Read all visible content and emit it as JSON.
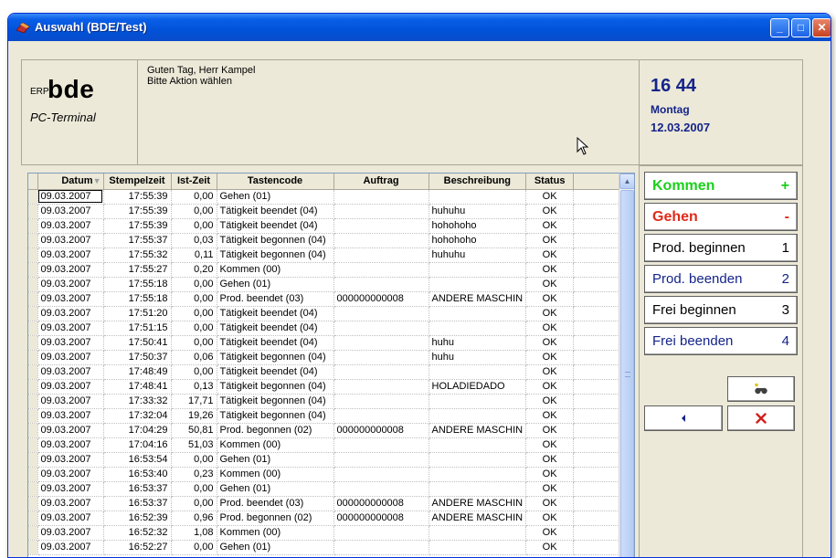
{
  "window": {
    "title": "Auswahl (BDE/Test)",
    "buttons": {
      "minimize": "_",
      "maximize": "□",
      "close": "✕"
    }
  },
  "header": {
    "logo_erp": "ERP",
    "logo_bde": "bde",
    "logo_sub": "PC-Terminal",
    "greeting_line1": "Guten Tag, Herr Kampel",
    "greeting_line2": "Bitte Aktion wählen",
    "time": "16 44",
    "weekday": "Montag",
    "date": "12.03.2007"
  },
  "table": {
    "columns": [
      "Datum",
      "Stempelzeit",
      "Ist-Zeit",
      "Tastencode",
      "Auftrag",
      "Beschreibung",
      "Status"
    ],
    "rows": [
      [
        "09.03.2007",
        "17:55:39",
        "0,00",
        "Gehen (01)",
        "",
        "",
        "OK"
      ],
      [
        "09.03.2007",
        "17:55:39",
        "0,00",
        "Tätigkeit beendet (04)",
        "",
        "huhuhu",
        "OK"
      ],
      [
        "09.03.2007",
        "17:55:39",
        "0,00",
        "Tätigkeit beendet (04)",
        "",
        "hohohoho",
        "OK"
      ],
      [
        "09.03.2007",
        "17:55:37",
        "0,03",
        "Tätigkeit begonnen (04)",
        "",
        "hohohoho",
        "OK"
      ],
      [
        "09.03.2007",
        "17:55:32",
        "0,11",
        "Tätigkeit begonnen (04)",
        "",
        "huhuhu",
        "OK"
      ],
      [
        "09.03.2007",
        "17:55:27",
        "0,20",
        "Kommen (00)",
        "",
        "",
        "OK"
      ],
      [
        "09.03.2007",
        "17:55:18",
        "0,00",
        "Gehen (01)",
        "",
        "",
        "OK"
      ],
      [
        "09.03.2007",
        "17:55:18",
        "0,00",
        "Prod. beendet (03)",
        "000000000008",
        "ANDERE MASCHIN",
        "OK"
      ],
      [
        "09.03.2007",
        "17:51:20",
        "0,00",
        "Tätigkeit beendet (04)",
        "",
        "",
        "OK"
      ],
      [
        "09.03.2007",
        "17:51:15",
        "0,00",
        "Tätigkeit beendet (04)",
        "",
        "",
        "OK"
      ],
      [
        "09.03.2007",
        "17:50:41",
        "0,00",
        "Tätigkeit beendet (04)",
        "",
        "huhu",
        "OK"
      ],
      [
        "09.03.2007",
        "17:50:37",
        "0,06",
        "Tätigkeit begonnen (04)",
        "",
        "huhu",
        "OK"
      ],
      [
        "09.03.2007",
        "17:48:49",
        "0,00",
        "Tätigkeit beendet (04)",
        "",
        "",
        "OK"
      ],
      [
        "09.03.2007",
        "17:48:41",
        "0,13",
        "Tätigkeit begonnen (04)",
        "",
        "HOLADIEDADO",
        "OK"
      ],
      [
        "09.03.2007",
        "17:33:32",
        "17,71",
        "Tätigkeit begonnen (04)",
        "",
        "",
        "OK"
      ],
      [
        "09.03.2007",
        "17:32:04",
        "19,26",
        "Tätigkeit begonnen (04)",
        "",
        "",
        "OK"
      ],
      [
        "09.03.2007",
        "17:04:29",
        "50,81",
        "Prod. begonnen (02)",
        "000000000008",
        "ANDERE MASCHIN",
        "OK"
      ],
      [
        "09.03.2007",
        "17:04:16",
        "51,03",
        "Kommen (00)",
        "",
        "",
        "OK"
      ],
      [
        "09.03.2007",
        "16:53:54",
        "0,00",
        "Gehen (01)",
        "",
        "",
        "OK"
      ],
      [
        "09.03.2007",
        "16:53:40",
        "0,23",
        "Kommen (00)",
        "",
        "",
        "OK"
      ],
      [
        "09.03.2007",
        "16:53:37",
        "0,00",
        "Gehen (01)",
        "",
        "",
        "OK"
      ],
      [
        "09.03.2007",
        "16:53:37",
        "0,00",
        "Prod. beendet (03)",
        "000000000008",
        "ANDERE MASCHIN",
        "OK"
      ],
      [
        "09.03.2007",
        "16:52:39",
        "0,96",
        "Prod. begonnen (02)",
        "000000000008",
        "ANDERE MASCHIN",
        "OK"
      ],
      [
        "09.03.2007",
        "16:52:32",
        "1,08",
        "Kommen (00)",
        "",
        "",
        "OK"
      ],
      [
        "09.03.2007",
        "16:52:27",
        "0,00",
        "Gehen (01)",
        "",
        "",
        "OK"
      ]
    ]
  },
  "actions": {
    "kommen": {
      "label": "Kommen",
      "key": "+"
    },
    "gehen": {
      "label": "Gehen",
      "key": "-"
    },
    "prod_beginnen": {
      "label": "Prod. beginnen",
      "key": "1"
    },
    "prod_beenden": {
      "label": "Prod. beenden",
      "key": "2"
    },
    "frei_beginnen": {
      "label": "Frei beginnen",
      "key": "3"
    },
    "frei_beenden": {
      "label": "Frei beenden",
      "key": "4"
    },
    "search_icon": "binoculars-icon",
    "back_icon": "arrow-left-icon",
    "cancel_icon": "close-x-icon"
  },
  "colors": {
    "kommen": "#1bd01b",
    "gehen": "#e02a1a",
    "header_accent": "#14248a",
    "titlebar": "#0052d8"
  }
}
